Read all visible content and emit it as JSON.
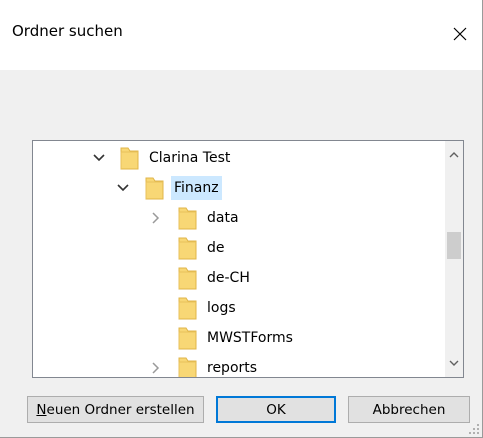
{
  "window": {
    "title": "Ordner suchen"
  },
  "tree": {
    "items": [
      {
        "label": "Clarina Test",
        "expanded": true,
        "has_children": true,
        "selected": false
      },
      {
        "label": "Finanz",
        "expanded": true,
        "has_children": true,
        "selected": true
      },
      {
        "label": "data",
        "expanded": false,
        "has_children": true,
        "selected": false
      },
      {
        "label": "de",
        "expanded": false,
        "has_children": false,
        "selected": false
      },
      {
        "label": "de-CH",
        "expanded": false,
        "has_children": false,
        "selected": false
      },
      {
        "label": "logs",
        "expanded": false,
        "has_children": false,
        "selected": false
      },
      {
        "label": "MWSTForms",
        "expanded": false,
        "has_children": false,
        "selected": false
      },
      {
        "label": "reports",
        "expanded": false,
        "has_children": true,
        "selected": false
      }
    ]
  },
  "buttons": {
    "new_folder_accel": "N",
    "new_folder_rest": "euen Ordner erstellen",
    "ok": "OK",
    "cancel": "Abbrechen"
  },
  "colors": {
    "selection": "#cce8ff",
    "default_button_border": "#0078d7",
    "folder": "#f8d775"
  },
  "icons": [
    "close-icon",
    "chevron-down-icon",
    "chevron-right-icon",
    "folder-icon",
    "scroll-up-icon",
    "scroll-down-icon",
    "resize-grip-icon"
  ]
}
